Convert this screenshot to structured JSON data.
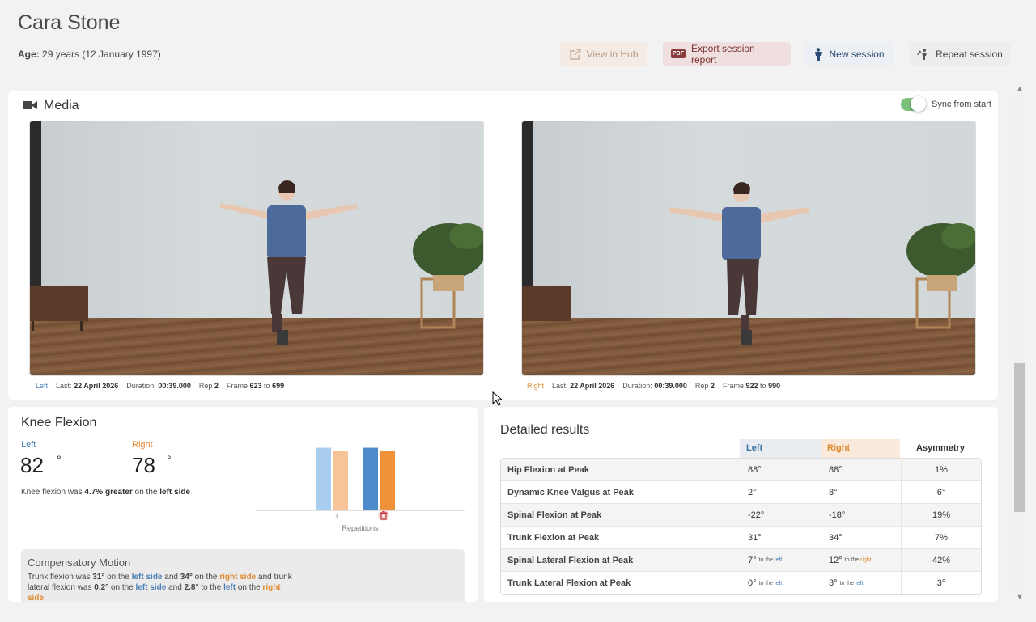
{
  "patient": {
    "name": "Cara Stone",
    "age_label": "Age:",
    "age_value": "29 years (12 January 1997)"
  },
  "header_buttons": {
    "view_hub": "View in Hub",
    "export": "Export session report",
    "pdf_badge": "PDF",
    "new_session": "New session",
    "repeat_session": "Repeat session"
  },
  "media": {
    "title": "Media",
    "sync_label": "Sync from start",
    "sync_on": true,
    "videos": [
      {
        "side": "Left",
        "last_label": "Last:",
        "last": "22 April 2026",
        "duration_label": "Duration:",
        "duration": "00:39.000",
        "rep_label": "Rep",
        "rep": "2",
        "frame_label": "Frame",
        "frame_from": "623",
        "to_label": "to",
        "frame_to": "699"
      },
      {
        "side": "Right",
        "last_label": "Last:",
        "last": "22 April 2026",
        "duration_label": "Duration:",
        "duration": "00:39.000",
        "rep_label": "Rep",
        "rep": "2",
        "frame_label": "Frame",
        "frame_from": "922",
        "to_label": "to",
        "frame_to": "990"
      }
    ]
  },
  "knee": {
    "title": "Knee Flexion",
    "left_label": "Left",
    "right_label": "Right",
    "left_value": "82",
    "right_value": "78",
    "degree": "°",
    "summary_pre": "Knee flexion was ",
    "summary_pct": "4.7% greater",
    "summary_mid": " on the ",
    "summary_side": "left side"
  },
  "chart_data": {
    "type": "bar",
    "categories": [
      "1",
      ""
    ],
    "series": [
      {
        "values": [
          82,
          82
        ]
      },
      {
        "values": [
          78,
          78
        ]
      }
    ],
    "xlabel": "Repetitions",
    "ylim": [
      0,
      90
    ],
    "colors": {
      "left_faded": "#a9cdee",
      "right_faded": "#f6c497",
      "left": "#4f8acb",
      "right": "#f0923a"
    }
  },
  "compensatory": {
    "title": "Compensatory Motion",
    "t1": "Trunk flexion was ",
    "v1": "31°",
    "t2": " on the ",
    "s1": "left side",
    "t3": " and ",
    "v2": "34°",
    "t4": " on the ",
    "s2": "right side",
    "t5": " and trunk lateral flexion was ",
    "v3": "0.2°",
    "t6": " on the ",
    "s3": "left side",
    "t7": " and ",
    "v4": "2.8°",
    "t8": " to the ",
    "s4": "left",
    "t9": " on the ",
    "s5": "right side"
  },
  "detailed": {
    "title": "Detailed results",
    "col_left": "Left",
    "col_right": "Right",
    "col_asym": "Asymmetry",
    "rows": [
      {
        "name": "Hip Flexion at Peak",
        "left": "88°",
        "right": "88°",
        "asym": "1%"
      },
      {
        "name": "Dynamic Knee Valgus at Peak",
        "left": "2°",
        "right": "8°",
        "asym": "6°"
      },
      {
        "name": "Spinal Flexion at Peak",
        "left": "-22°",
        "right": "-18°",
        "asym": "19%"
      },
      {
        "name": "Trunk Flexion at Peak",
        "left": "31°",
        "right": "34°",
        "asym": "7%"
      },
      {
        "name": "Spinal Lateral Flexion at Peak",
        "left": "7°",
        "left_dir": "to the",
        "left_dir_side": "left",
        "right": "12°",
        "right_dir": "to the",
        "right_dir_side": "right",
        "asym": "42%"
      },
      {
        "name": "Trunk Lateral Flexion at Peak",
        "left": "0°",
        "left_dir": "to the",
        "left_dir_side": "left",
        "right": "3°",
        "right_dir": "to the",
        "right_dir_side": "left",
        "asym": "3°"
      }
    ]
  },
  "colors": {
    "left_accent": "#4c7fb5",
    "right_accent": "#e08a33",
    "toggle_on": "#7cc07c"
  }
}
